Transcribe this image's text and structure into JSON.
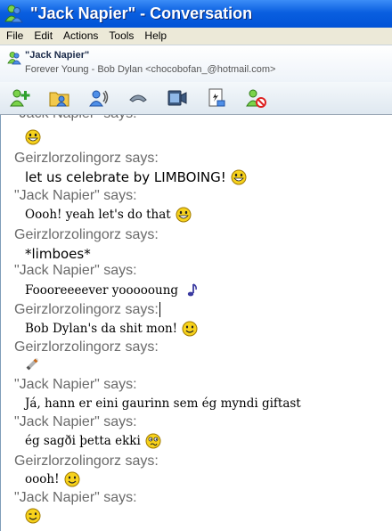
{
  "window": {
    "title": "\"Jack Napier\" - Conversation"
  },
  "menu": [
    "File",
    "Edit",
    "Actions",
    "Tools",
    "Help"
  ],
  "contact": {
    "name": "\"Jack Napier\"",
    "status": "Forever Young - Bob Dylan <chocobofan_@hotmail.com>"
  },
  "toolbar": {
    "icons": [
      "invite-contact-icon",
      "send-files-icon",
      "voice-icon",
      "call-phone-icon",
      "video-icon",
      "activities-icon",
      "block-contact-icon"
    ]
  },
  "messages": [
    {
      "sender_line": "\"Jack Napier\" says:",
      "text": "",
      "emoticon": "grin-emoticon"
    },
    {
      "sender_line": "Geirzlorzolingorz says:",
      "text": "let us celebrate by LIMBOING!",
      "emoticon": "grin-emoticon"
    },
    {
      "sender_line": "\"Jack Napier\" says:",
      "text": "Oooh! yeah let's do that",
      "emoticon": "grin-emoticon"
    },
    {
      "sender_line": "Geirzlorzolingorz says:",
      "text": "*limboes*",
      "emoticon": ""
    },
    {
      "sender_line": "\"Jack Napier\" says:",
      "text": "Foooreeeever yoooooung",
      "emoticon": "music-note-emoticon"
    },
    {
      "sender_line": "Geirzlorzolingorz says:",
      "text": "Bob Dylan's da shit mon!",
      "emoticon": "smile-emoticon"
    },
    {
      "sender_line": "Geirzlorzolingorz says:",
      "text": "",
      "emoticon": "cigarette-emoticon"
    },
    {
      "sender_line": "\"Jack Napier\" says:",
      "text": "Já, hann er eini gaurinn sem ég myndi giftast",
      "emoticon": ""
    },
    {
      "sender_line": "\"Jack Napier\" says:",
      "text": "ég sagði þetta ekki",
      "emoticon": "confused-emoticon"
    },
    {
      "sender_line": "Geirzlorzolingorz says:",
      "text": "oooh!",
      "emoticon": "smile-emoticon"
    },
    {
      "sender_line": "\"Jack Napier\" says:",
      "text": "",
      "emoticon": "wink-emoticon"
    }
  ],
  "colors": {
    "titlebar": "#0a5fe0",
    "menubar": "#ece9d8",
    "sender_text": "#6a6a6a",
    "emoticon_yellow": "#f7d21c"
  }
}
